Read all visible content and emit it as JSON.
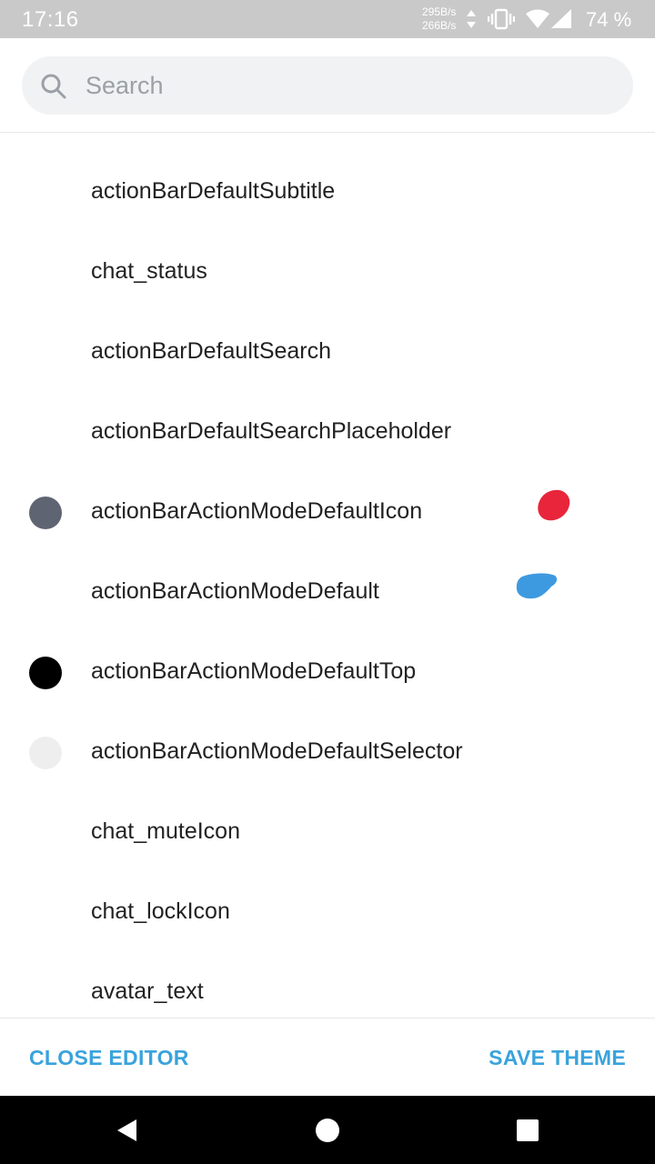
{
  "status_bar": {
    "time": "17:16",
    "net_up": "295B/s",
    "net_down": "266B/s",
    "battery": "74 %",
    "icons": [
      "data-arrows-icon",
      "vibrate-icon",
      "wifi-icon",
      "signal-icon"
    ]
  },
  "search": {
    "placeholder": "Search",
    "value": ""
  },
  "list": {
    "items": [
      {
        "label": "actionBarDefaultSubtitle",
        "swatch": null
      },
      {
        "label": "chat_status",
        "swatch": null
      },
      {
        "label": "actionBarDefaultSearch",
        "swatch": null
      },
      {
        "label": "actionBarDefaultSearchPlaceholder",
        "swatch": null
      },
      {
        "label": "actionBarActionModeDefaultIcon",
        "swatch": "#5f6472"
      },
      {
        "label": "actionBarActionModeDefault",
        "swatch": null
      },
      {
        "label": "actionBarActionModeDefaultTop",
        "swatch": "#000000"
      },
      {
        "label": "actionBarActionModeDefaultSelector",
        "swatch": "#eeeeee"
      },
      {
        "label": "chat_muteIcon",
        "swatch": null
      },
      {
        "label": "chat_lockIcon",
        "swatch": null
      },
      {
        "label": "avatar_text",
        "swatch": null
      }
    ]
  },
  "marks": {
    "red": "#e8253b",
    "blue": "#3e9ae0"
  },
  "actions": {
    "close_editor": "CLOSE EDITOR",
    "save_theme": "SAVE THEME",
    "accent": "#3aa3dc"
  },
  "nav": {
    "icons": [
      "back-icon",
      "home-icon",
      "recents-icon"
    ]
  }
}
